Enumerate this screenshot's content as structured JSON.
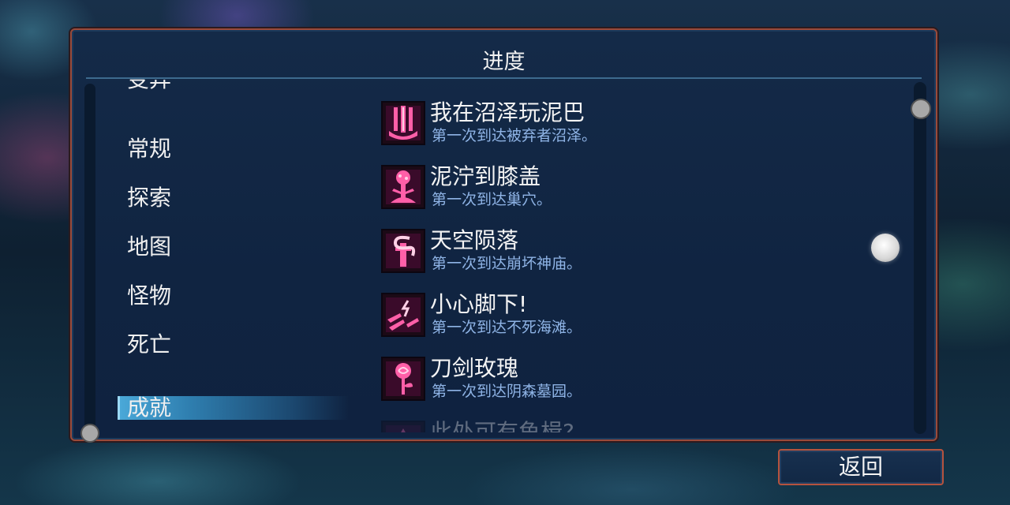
{
  "panel": {
    "title": "进度"
  },
  "categories": [
    {
      "label": "变异",
      "selected": false
    },
    {
      "label": "常规",
      "selected": false
    },
    {
      "label": "探索",
      "selected": false
    },
    {
      "label": "地图",
      "selected": false
    },
    {
      "label": "怪物",
      "selected": false
    },
    {
      "label": "死亡",
      "selected": false
    },
    {
      "label": "成就",
      "selected": true
    }
  ],
  "achievements": [
    {
      "title": "我在沼泽玩泥巴",
      "description": "第一次到达被弃者沼泽。",
      "icon": "swamp-pillars-icon"
    },
    {
      "title": "泥泞到膝盖",
      "description": "第一次到达巢穴。",
      "icon": "mushroom-tree-icon"
    },
    {
      "title": "天空陨落",
      "description": "第一次到达崩坏神庙。",
      "icon": "serpent-sword-icon"
    },
    {
      "title": "小心脚下!",
      "description": "第一次到达不死海滩。",
      "icon": "crumbling-ground-icon"
    },
    {
      "title": "刀剑玫瑰",
      "description": "第一次到达阴森墓园。",
      "icon": "rose-icon"
    },
    {
      "title": "此处可有鱼楫?",
      "description": "",
      "icon": "partial-icon"
    }
  ],
  "buttons": {
    "back_label": "返回"
  },
  "colors": {
    "accent_selected": "#3a96c8",
    "frame_border": "#9a4a3a",
    "icon_glow": "#ff3d8f",
    "desc_text": "#8fb4e6"
  }
}
